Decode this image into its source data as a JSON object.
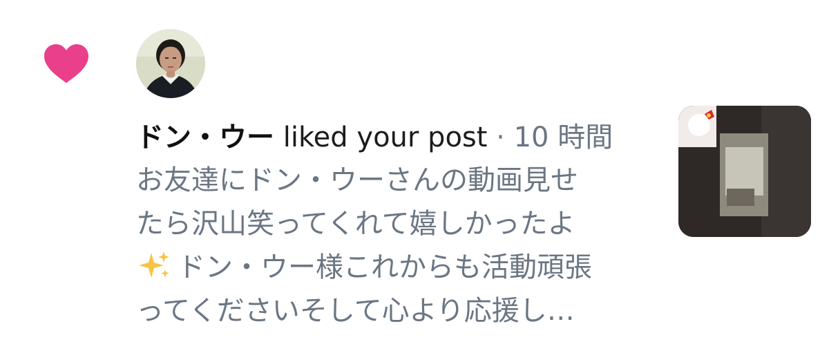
{
  "notification": {
    "icon": "heart-icon",
    "heart_color": "#ea3f8b",
    "avatar": "user-avatar",
    "username": "ドン・ウー",
    "action": " liked your post",
    "separator": " · ",
    "time": "10 時間",
    "preview_lines": [
      "お友達にドン・ウーさんの動画見せ",
      "たら沢山笑ってくれて嬉しかったよ",
      "ドン・ウー様これからも活動頑張",
      "ってくださいそして心より応援し…"
    ],
    "preview_emoji": "sparkles-icon",
    "thumbnail": "post-thumbnail"
  }
}
